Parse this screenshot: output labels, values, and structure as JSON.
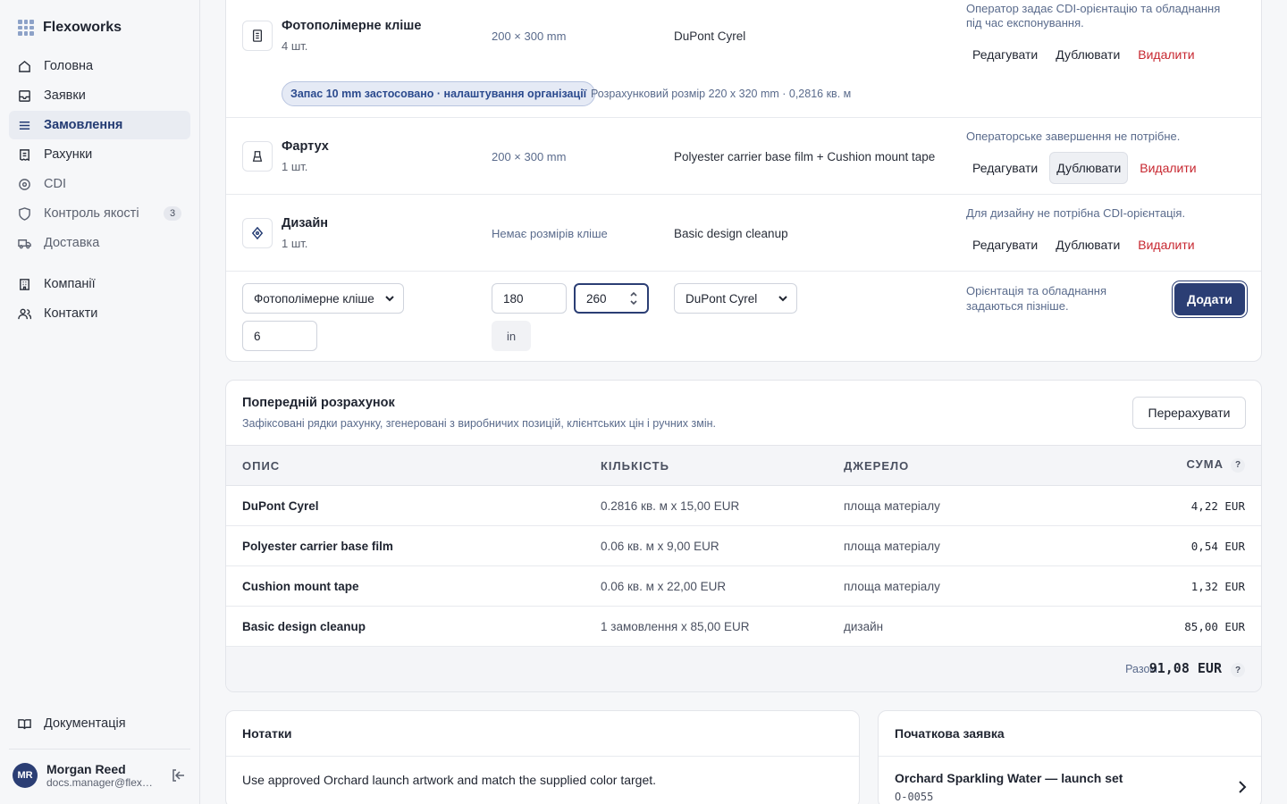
{
  "brand": {
    "name": "Flexoworks"
  },
  "nav": {
    "items": [
      {
        "label": "Головна",
        "icon": "home-icon"
      },
      {
        "label": "Заявки",
        "icon": "inbox-icon"
      },
      {
        "label": "Замовлення",
        "icon": "list-icon",
        "active": true
      },
      {
        "label": "Рахунки",
        "icon": "receipt-icon"
      },
      {
        "label": "CDI",
        "icon": "target-icon"
      },
      {
        "label": "Контроль якості",
        "icon": "shield-icon",
        "badge": "3"
      },
      {
        "label": "Доставка",
        "icon": "truck-icon"
      }
    ],
    "secondary": [
      {
        "label": "Компанії",
        "icon": "building-icon"
      },
      {
        "label": "Контакти",
        "icon": "users-icon"
      }
    ],
    "docs": "Документація"
  },
  "user": {
    "initials": "MR",
    "name": "Morgan Reed",
    "email": "docs.manager@flexoworks.example"
  },
  "items": [
    {
      "title": "Фотополімерне кліше",
      "qty": "4 шт.",
      "size": "200 × 300 mm",
      "material": "DuPont Cyrel",
      "note": "Оператор задає CDI-орієнтацію та обладнання під час експонування.",
      "pill": "Запас 10 mm застосовано · налаштування організації",
      "calc": "Розрахунковий розмір 220 x 320 mm · 0,2816 кв. м"
    },
    {
      "title": "Фартух",
      "qty": "1 шт.",
      "size": "200 × 300 mm",
      "material": "Polyester carrier base film + Cushion mount tape",
      "note": "Операторське завершення не потрібне."
    },
    {
      "title": "Дизайн",
      "qty": "1 шт.",
      "size": "Немає розмірів кліше",
      "material": "Basic design cleanup",
      "note": "Для дизайну не потрібна CDI-орієнтація."
    }
  ],
  "actions": {
    "edit": "Редагувати",
    "duplicate": "Дублювати",
    "delete": "Видалити"
  },
  "add_form": {
    "type": "Фотополімерне кліше",
    "width": "180",
    "height": "260",
    "material": "DuPont Cyrel",
    "qty": "6",
    "unit": "in",
    "note": "Орієнтація та обладнання задаються пізніше.",
    "add": "Додати"
  },
  "estimate": {
    "title": "Попередній розрахунок",
    "subtitle": "Зафіксовані рядки рахунку, згенеровані з виробничих позицій, клієнтських цін і ручних змін.",
    "recalc": "Перерахувати",
    "columns": {
      "desc": "ОПИС",
      "qty": "КІЛЬКІСТЬ",
      "src": "ДЖЕРЕЛО",
      "sum": "СУМА"
    },
    "help": "?",
    "rows": [
      {
        "desc": "DuPont Cyrel",
        "qty": "0.2816 кв. м x 15,00 EUR",
        "src": "площа матеріалу",
        "sum": "4,22 EUR"
      },
      {
        "desc": "Polyester carrier base film",
        "qty": "0.06 кв. м x 9,00 EUR",
        "src": "площа матеріалу",
        "sum": "0,54 EUR"
      },
      {
        "desc": "Cushion mount tape",
        "qty": "0.06 кв. м x 22,00 EUR",
        "src": "площа матеріалу",
        "sum": "1,32 EUR"
      },
      {
        "desc": "Basic design cleanup",
        "qty": "1 замовлення x 85,00 EUR",
        "src": "дизайн",
        "sum": "85,00 EUR"
      }
    ],
    "total_label": "Разом",
    "total": "91,08 EUR"
  },
  "notes": {
    "title": "Нотатки",
    "text": "Use approved Orchard launch artwork and match the supplied color target."
  },
  "request": {
    "title": "Початкова заявка",
    "name": "Orchard Sparkling Water — launch set",
    "code": "O-0055"
  }
}
